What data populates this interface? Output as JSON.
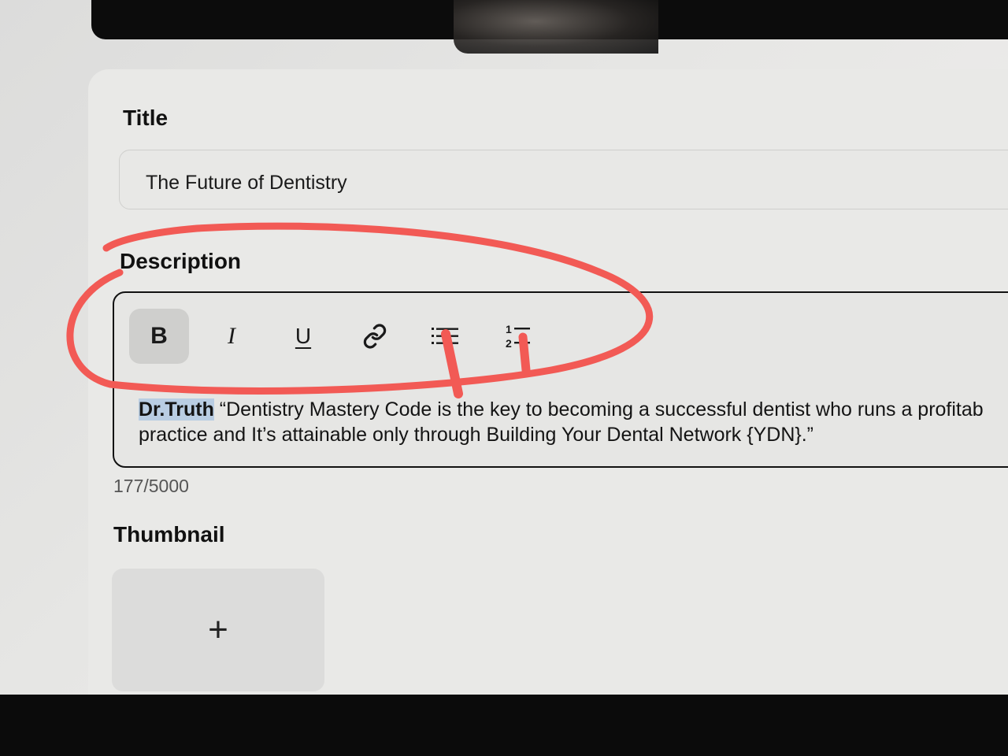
{
  "form": {
    "title_label": "Title",
    "title_value": "The Future of Dentistry",
    "description_label": "Description",
    "toolbar": {
      "bold": "B",
      "italic": "I",
      "underline": "U",
      "link_icon": "link-icon",
      "bulleted_list_icon": "bulleted-list-icon",
      "numbered_list_icon": "numbered-list-icon"
    },
    "description": {
      "highlighted": "Dr.Truth",
      "line1_rest": " “Dentistry Mastery Code is the key to becoming a successful dentist who runs a profitab",
      "line2": "practice and It’s attainable only through Building Your Dental Network {YDN}.”"
    },
    "char_count": "177/5000",
    "thumbnail_label": "Thumbnail",
    "thumbnail_add": "+"
  },
  "colors": {
    "annotation": "#f25a55",
    "highlight": "#b9cde3"
  }
}
